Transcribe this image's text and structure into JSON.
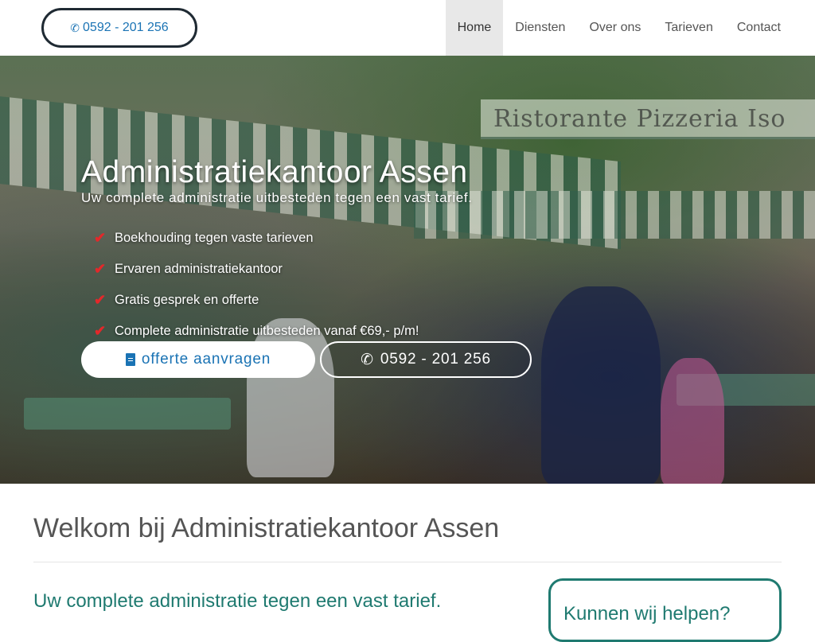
{
  "nav": {
    "phone": "0592 - 201 256",
    "menu": [
      "Home",
      "Diensten",
      "Over ons",
      "Tarieven",
      "Contact"
    ],
    "active": "Home"
  },
  "hero": {
    "sign_text": "Ristorante  Pizzeria  Iso",
    "title": "Administratiekantoor Assen",
    "subtitle": "Uw complete administratie uitbesteden tegen een vast tarief.",
    "checks": [
      "Boekhouding tegen vaste tarieven",
      "Ervaren administratiekantoor",
      "Gratis gesprek en offerte",
      "Complete administratie uitbesteden vanaf €69,- p/m!"
    ],
    "btn_offerte": "offerte aanvragen",
    "btn_phone": "0592 - 201 256"
  },
  "welcome": {
    "title": "Welkom bij Administratiekantoor Assen",
    "subheading": "Uw complete administratie tegen een vast tarief.",
    "side_title": "Kunnen wij helpen?"
  },
  "colors": {
    "link_blue": "#1a73b4",
    "teal": "#1f7a70",
    "check_red": "#e3282a",
    "nav_active_bg": "#e8e8e8"
  },
  "icons": {
    "phone": "phone-icon",
    "check": "check-icon",
    "document": "document-icon"
  }
}
